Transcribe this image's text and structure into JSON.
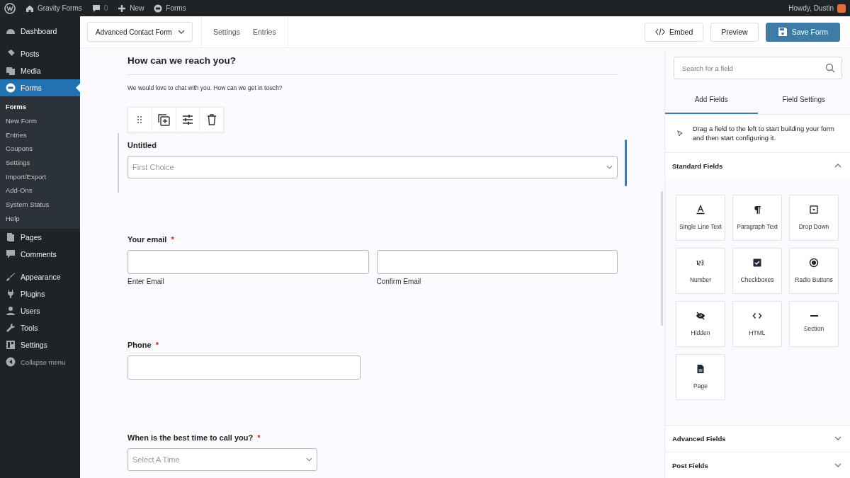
{
  "admin_bar": {
    "items": [
      {
        "kind": "wp"
      },
      {
        "kind": "home",
        "label": "Gravity Forms"
      },
      {
        "kind": "comments",
        "label": "0"
      },
      {
        "kind": "new",
        "label": "New"
      },
      {
        "kind": "forms",
        "label": "Forms"
      }
    ],
    "greeting": "Howdy, Dustin"
  },
  "sidebar": {
    "items": [
      {
        "kind": "dashboard",
        "label": "Dashboard",
        "selected": false
      },
      {
        "kind": "pin",
        "label": "Posts",
        "selected": false
      },
      {
        "kind": "media",
        "label": "Media",
        "selected": false
      },
      {
        "kind": "forms",
        "label": "Forms",
        "selected": true,
        "children": [
          {
            "label": "Forms",
            "selected": true
          },
          {
            "label": "New Form",
            "selected": false
          },
          {
            "label": "Entries",
            "selected": false
          },
          {
            "label": "Coupons",
            "selected": false
          },
          {
            "label": "Settings",
            "selected": false
          },
          {
            "label": "Import/Export",
            "selected": false
          },
          {
            "label": "Add-Ons",
            "selected": false
          },
          {
            "label": "System Status",
            "selected": false
          },
          {
            "label": "Help",
            "selected": false
          }
        ]
      },
      {
        "kind": "page",
        "label": "Pages",
        "selected": false
      },
      {
        "kind": "comment",
        "label": "Comments",
        "selected": false
      },
      {
        "kind": "brush",
        "label": "Appearance",
        "selected": false
      },
      {
        "kind": "plug",
        "label": "Plugins",
        "selected": false
      },
      {
        "kind": "user",
        "label": "Users",
        "selected": false
      },
      {
        "kind": "wrench",
        "label": "Tools",
        "selected": false
      },
      {
        "kind": "settings",
        "label": "Settings",
        "selected": false
      },
      {
        "kind": "collapse",
        "label": "Collapse menu",
        "selected": false
      }
    ]
  },
  "toolbar": {
    "form_select": "Advanced Contact Form",
    "links": [
      "Settings",
      "Entries"
    ],
    "buttons": [
      {
        "kind": "embed",
        "label": "Embed"
      },
      {
        "kind": "plain",
        "label": "Preview"
      },
      {
        "kind": "primary",
        "label": "Save Form"
      }
    ]
  },
  "form": {
    "heading": "How can we reach you?",
    "description": "We would love to chat with you. How can we get in touch?",
    "fields": [
      {
        "kind": "select",
        "label": "Untitled",
        "placeholder": "First Choice",
        "selected": true
      },
      {
        "kind": "email",
        "label": "Your email",
        "required_mark": "*",
        "sublabels": [
          "Enter Email",
          "Confirm Email"
        ],
        "selected": false
      },
      {
        "kind": "text",
        "label": "Phone",
        "required_mark": "*",
        "selected": false
      },
      {
        "kind": "select",
        "label": "When is the best time to call you?",
        "required_mark": "*",
        "placeholder": "Select A Time",
        "selected": false
      }
    ]
  },
  "panel": {
    "search": {
      "placeholder": "Search for a field"
    },
    "tabs": [
      {
        "label": "Add Fields",
        "selected": true
      },
      {
        "label": "Field Settings",
        "selected": false
      }
    ],
    "hint": "Drag a field to the left to start building your form and then start configuring it.",
    "sections": [
      {
        "title": "Standard Fields",
        "expanded": true,
        "fields": [
          {
            "kind": "text",
            "label": "Single Line Text"
          },
          {
            "kind": "para",
            "label": "Paragraph Text"
          },
          {
            "kind": "dropdown",
            "label": "Drop Down"
          },
          {
            "kind": "number",
            "label": "Number"
          },
          {
            "kind": "checkbox",
            "label": "Checkboxes"
          },
          {
            "kind": "radio",
            "label": "Radio Buttons"
          },
          {
            "kind": "hidden",
            "label": "Hidden"
          },
          {
            "kind": "html",
            "label": "HTML"
          },
          {
            "kind": "section",
            "label": "Section"
          },
          {
            "kind": "page",
            "label": "Page"
          }
        ]
      },
      {
        "title": "Advanced Fields",
        "expanded": false
      },
      {
        "title": "Post Fields",
        "expanded": false
      }
    ]
  }
}
